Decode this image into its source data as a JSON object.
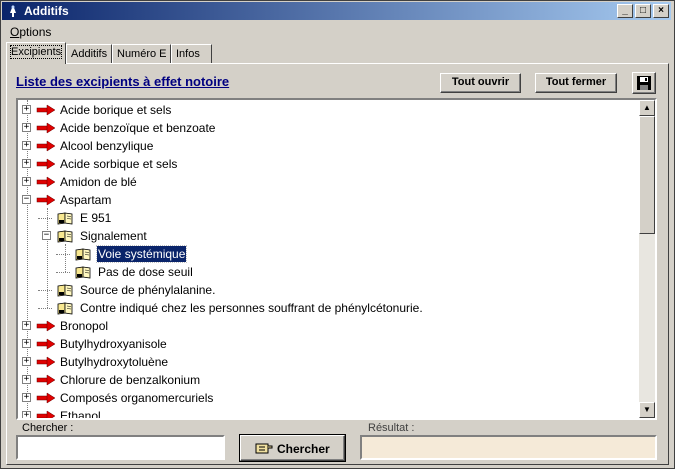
{
  "window": {
    "title": "Additifs",
    "controls": {
      "minimize": "_",
      "maximize": "□",
      "close": "×"
    }
  },
  "menu": {
    "options_underlined": "O",
    "options_rest": "ptions"
  },
  "tabs": [
    {
      "label": "Excipients",
      "active": true
    },
    {
      "label": "Additifs",
      "active": false
    },
    {
      "label": "Numéro E",
      "active": false
    },
    {
      "label": "Infos",
      "active": false
    }
  ],
  "list_title": "Liste des excipients à effet notoire",
  "toolbar": {
    "open_all": "Tout ouvrir",
    "close_all": "Tout fermer",
    "save_icon": "floppy-disk-icon"
  },
  "tree": [
    {
      "label": "Acide borique et sels",
      "level": 0,
      "expander": "+",
      "icon": "red-arrow-icon"
    },
    {
      "label": "Acide benzoïque et benzoate",
      "level": 0,
      "expander": "+",
      "icon": "red-arrow-icon"
    },
    {
      "label": "Alcool benzylique",
      "level": 0,
      "expander": "+",
      "icon": "red-arrow-icon"
    },
    {
      "label": "Acide sorbique et sels",
      "level": 0,
      "expander": "+",
      "icon": "red-arrow-icon"
    },
    {
      "label": "Amidon de blé",
      "level": 0,
      "expander": "+",
      "icon": "red-arrow-icon"
    },
    {
      "label": "Aspartam",
      "level": 0,
      "expander": "−",
      "icon": "red-arrow-icon"
    },
    {
      "label": "E 951",
      "level": 1,
      "expander": "",
      "icon": "open-book-icon"
    },
    {
      "label": "Signalement",
      "level": 1,
      "expander": "−",
      "icon": "open-book-icon"
    },
    {
      "label": "Voie systémique",
      "level": 2,
      "expander": "",
      "icon": "open-book-icon",
      "selected": true
    },
    {
      "label": "Pas de dose seuil",
      "level": 2,
      "expander": "",
      "icon": "open-book-icon"
    },
    {
      "label": "Source de phénylalanine.",
      "level": 1,
      "expander": "",
      "icon": "open-book-icon"
    },
    {
      "label": "Contre indiqué chez les personnes souffrant de phénylcétonurie.",
      "level": 1,
      "expander": "",
      "icon": "open-book-icon"
    },
    {
      "label": "Bronopol",
      "level": 0,
      "expander": "+",
      "icon": "red-arrow-icon"
    },
    {
      "label": "Butylhydroxyanisole",
      "level": 0,
      "expander": "+",
      "icon": "red-arrow-icon"
    },
    {
      "label": "Butylhydroxytoluène",
      "level": 0,
      "expander": "+",
      "icon": "red-arrow-icon"
    },
    {
      "label": "Chlorure de benzalkonium",
      "level": 0,
      "expander": "+",
      "icon": "red-arrow-icon"
    },
    {
      "label": "Composés organomercuriels",
      "level": 0,
      "expander": "+",
      "icon": "red-arrow-icon"
    },
    {
      "label": "Ethanol",
      "level": 0,
      "expander": "+",
      "icon": "red-arrow-icon"
    }
  ],
  "search": {
    "label": "Chercher :",
    "value": "",
    "button": "Chercher"
  },
  "result": {
    "label": "Résultat :",
    "value": ""
  },
  "colors": {
    "titlebar_start": "#0a246a",
    "titlebar_end": "#a6caf0",
    "selection": "#0a246a",
    "result_bg": "#f5ead8",
    "arrow": "#e00000"
  }
}
